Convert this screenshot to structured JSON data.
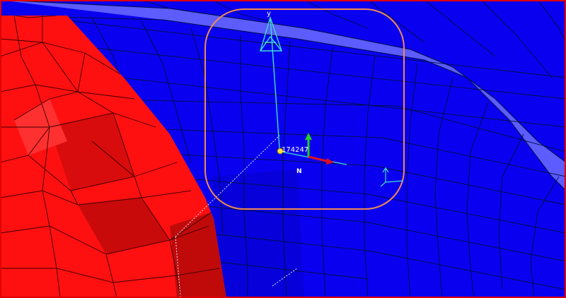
{
  "viewport": {
    "node_label": "174247",
    "normal_label": "N",
    "axis_label": "y",
    "colors": {
      "mesh_blue": "#0a00f0",
      "mesh_blue_dark": "#0800c8",
      "band_light": "#5c5cff",
      "part_red": "#ff1010",
      "part_red_dark": "#c80a0a",
      "frame_red": "#e00000",
      "tool_orange": "#f08a50",
      "triad_cyan": "#40e0d0",
      "node_yellow": "#ffe23a"
    }
  }
}
